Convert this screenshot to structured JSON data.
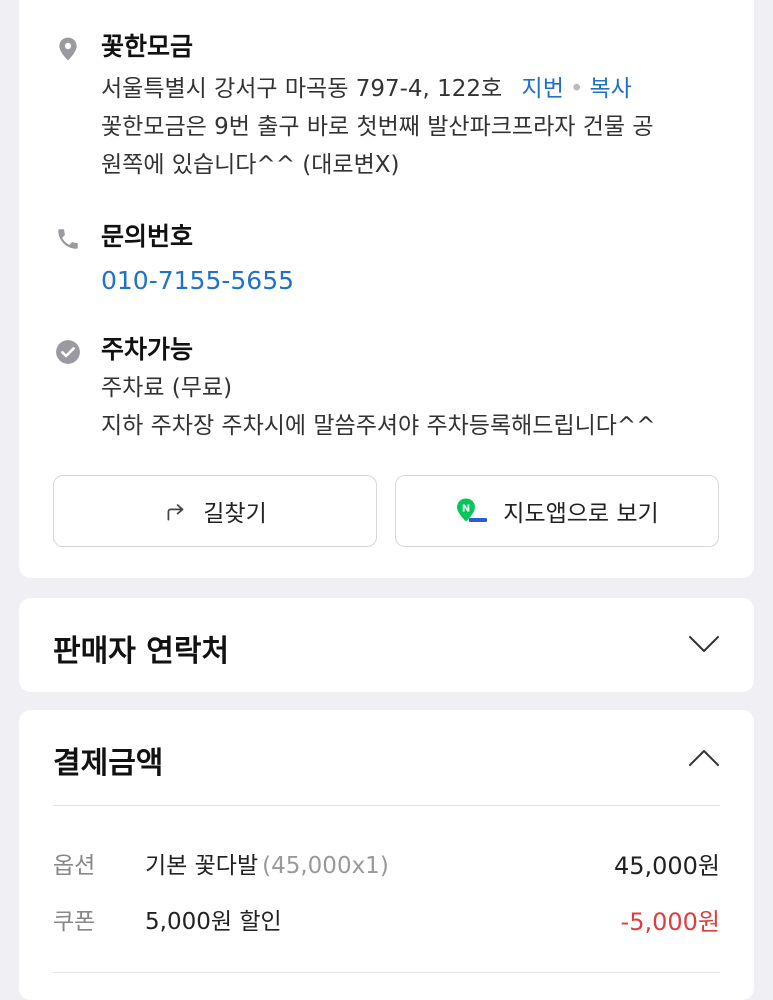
{
  "place": {
    "name": "꽃한모금",
    "address": "서울특별시 강서구 마곡동 797-4, 122호",
    "address_link_jibun": "지번",
    "address_link_copy": "복사",
    "description_line1": "꽃한모금은 9번 출구 바로 첫번째 발산파크프라자 건물 공",
    "description_line2": "원쪽에 있습니다^^ (대로변X)"
  },
  "contact": {
    "title": "문의번호",
    "phone": "010-7155-5655"
  },
  "parking": {
    "title": "주차가능",
    "fee": "주차료 (무료)",
    "note": "지하 주차장 주차시에 말씀주셔야 주차등록해드립니다^^"
  },
  "buttons": {
    "directions": "길찾기",
    "map_app": "지도앱으로 보기"
  },
  "seller": {
    "title": "판매자 연락처"
  },
  "payment": {
    "title": "결제금액",
    "rows": [
      {
        "label": "옵션",
        "desc": "기본 꽃다발",
        "qty": "(45,000x1)",
        "amount": "45,000원"
      },
      {
        "label": "쿠폰",
        "desc": "5,000원 할인",
        "qty": "",
        "amount": "-5,000원"
      }
    ]
  },
  "colors": {
    "link": "#1f72c7",
    "negative": "#e03d3d",
    "map_green": "#03c75a"
  }
}
